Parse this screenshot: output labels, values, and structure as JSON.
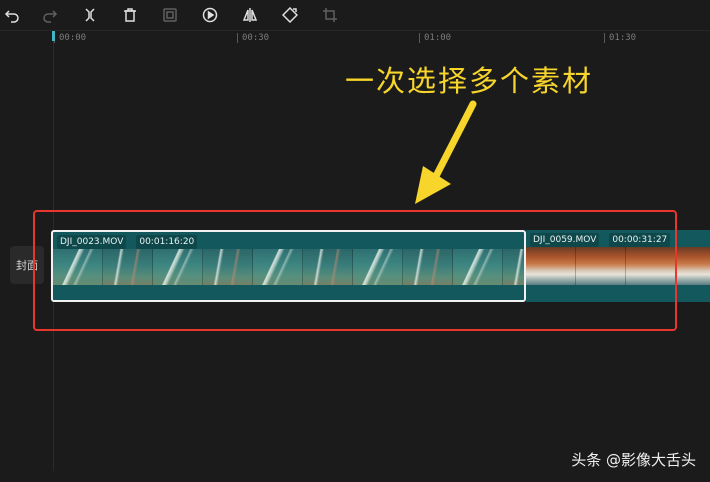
{
  "toolbar": {
    "tools": [
      {
        "name": "undo-icon",
        "enabled": true
      },
      {
        "name": "redo-icon",
        "enabled": false
      },
      {
        "name": "split-icon",
        "enabled": true
      },
      {
        "name": "delete-icon",
        "enabled": true
      },
      {
        "name": "freeze-frame-icon",
        "enabled": false
      },
      {
        "name": "play-circle-icon",
        "enabled": true
      },
      {
        "name": "mirror-icon",
        "enabled": true
      },
      {
        "name": "rotate-icon",
        "enabled": true
      },
      {
        "name": "crop-icon",
        "enabled": false
      }
    ]
  },
  "ruler": {
    "ticks": [
      "00:00",
      "00:30",
      "01:00",
      "01:30"
    ]
  },
  "annotation": {
    "text": "一次选择多个素材",
    "color": "#f7d52a"
  },
  "cover": {
    "label": "封面"
  },
  "timeline": {
    "clips": [
      {
        "name": "DJI_0023.MOV",
        "duration": "00:01:16:20",
        "selected": true,
        "thumbnail": "ocean"
      },
      {
        "name": "DJI_0059.MOV",
        "duration": "00:00:31:27",
        "selected": false,
        "thumbnail": "beach"
      }
    ]
  },
  "colors": {
    "background": "#1b1b1c",
    "clip": "#13585c",
    "selection_box": "#e8352d",
    "accent": "#3fb7c9"
  },
  "watermark": {
    "text": "头条 @影像大舌头"
  }
}
